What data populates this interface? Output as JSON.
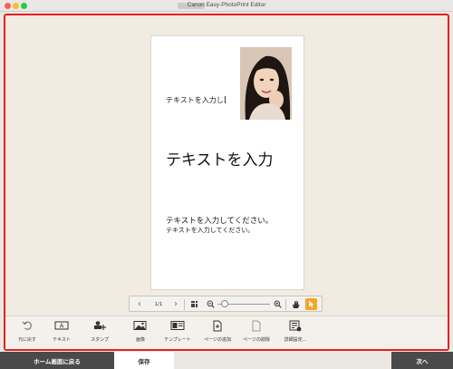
{
  "window": {
    "title": "Canon Easy-PhotoPrint Editor"
  },
  "page": {
    "text_small": "テキストを入力し",
    "text_large": "テキストを入力",
    "text_body1": "テキストを入力してください。",
    "text_body2": "テキストを入力してください。"
  },
  "navbar": {
    "prev": "‹",
    "page_indicator": "1/1",
    "next": "›"
  },
  "toolbar": {
    "items": [
      {
        "label": "元に戻す",
        "icon": "undo-icon"
      },
      {
        "label": "テキスト",
        "icon": "text-icon"
      },
      {
        "label": "スタンプ",
        "icon": "stamp-icon"
      },
      {
        "label": "画像",
        "icon": "image-icon"
      },
      {
        "label": "テンプレート",
        "icon": "template-icon"
      },
      {
        "label": "ページの追加",
        "icon": "add-page-icon"
      },
      {
        "label": "ページの削除",
        "icon": "delete-page-icon"
      },
      {
        "label": "詳細設定...",
        "icon": "settings-icon"
      }
    ]
  },
  "bottom": {
    "home_label": "ホーム画面に戻る",
    "save_label": "保存",
    "next_label": "次へ"
  },
  "colors": {
    "highlight_frame": "#e3211f",
    "accent_pointer": "#f5a623",
    "dark_button": "#4a4a4a"
  }
}
